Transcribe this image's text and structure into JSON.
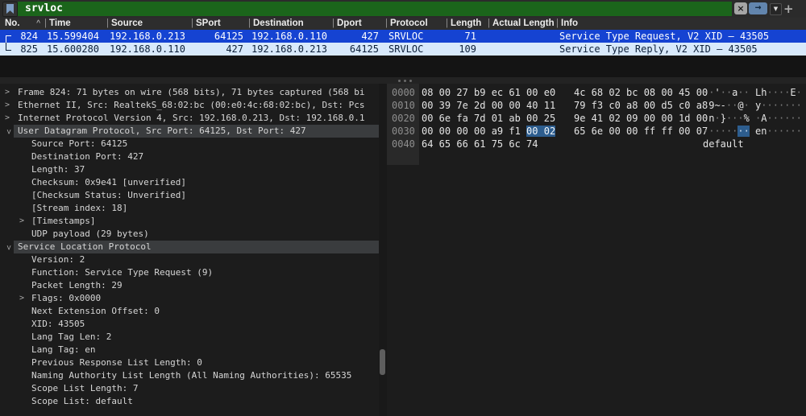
{
  "colors": {
    "filter_green": "#1b651b",
    "selected_row_blue": "#1543d2",
    "related_row_blue": "#d8e9fb",
    "byte_highlight_blue": "#2d5d8e",
    "detail_selected_gray": "#3a3c3e",
    "apply_button_blue": "#6285ad"
  },
  "filter_bar": {
    "query": "srvloc",
    "clear_label": "×",
    "apply_label": "→",
    "dropdown_label": "▼",
    "add_label": "+"
  },
  "packet_list": {
    "columns": [
      {
        "key": "no",
        "label": "No.",
        "sort": "^"
      },
      {
        "key": "time",
        "label": "Time"
      },
      {
        "key": "source",
        "label": "Source"
      },
      {
        "key": "sport",
        "label": "SPort"
      },
      {
        "key": "destination",
        "label": "Destination"
      },
      {
        "key": "dport",
        "label": "Dport"
      },
      {
        "key": "protocol",
        "label": "Protocol"
      },
      {
        "key": "length",
        "label": "Length"
      },
      {
        "key": "actual_length",
        "label": "Actual Length"
      },
      {
        "key": "info",
        "label": "Info"
      }
    ],
    "rows": [
      {
        "no": "824",
        "time": "15.599404",
        "source": "192.168.0.213",
        "sport": "64125",
        "destination": "192.168.0.110",
        "dport": "427",
        "protocol": "SRVLOC",
        "length": "71",
        "actual_length": "",
        "info": "Service Type Request, V2 XID – 43505",
        "selected": true,
        "bracket": "start"
      },
      {
        "no": "825",
        "time": "15.600280",
        "source": "192.168.0.110",
        "sport": "427",
        "destination": "192.168.0.213",
        "dport": "64125",
        "protocol": "SRVLOC",
        "length": "109",
        "actual_length": "",
        "info": "Service Type Reply, V2 XID – 43505",
        "selected": false,
        "bracket": "end"
      }
    ]
  },
  "packet_details": {
    "rows": [
      {
        "depth": 0,
        "chev": "collapsed",
        "text": "Frame 824: 71 bytes on wire (568 bits), 71 bytes captured (568 bi"
      },
      {
        "depth": 0,
        "chev": "collapsed",
        "text": "Ethernet II, Src: RealtekS_68:02:bc (00:e0:4c:68:02:bc), Dst: Pcs"
      },
      {
        "depth": 0,
        "chev": "collapsed",
        "text": "Internet Protocol Version 4, Src: 192.168.0.213, Dst: 192.168.0.1"
      },
      {
        "depth": 0,
        "chev": "expanded",
        "selected": true,
        "text": "User Datagram Protocol, Src Port: 64125, Dst Port: 427"
      },
      {
        "depth": 1,
        "text": "Source Port: 64125"
      },
      {
        "depth": 1,
        "text": "Destination Port: 427"
      },
      {
        "depth": 1,
        "text": "Length: 37"
      },
      {
        "depth": 1,
        "text": "Checksum: 0x9e41 [unverified]"
      },
      {
        "depth": 1,
        "text": "[Checksum Status: Unverified]"
      },
      {
        "depth": 1,
        "text": "[Stream index: 18]"
      },
      {
        "depth": 1,
        "chev": "collapsed",
        "text": "[Timestamps]"
      },
      {
        "depth": 1,
        "text": "UDP payload (29 bytes)"
      },
      {
        "depth": 0,
        "chev": "expanded",
        "selected": true,
        "text": "Service Location Protocol"
      },
      {
        "depth": 1,
        "text": "Version: 2"
      },
      {
        "depth": 1,
        "text": "Function: Service Type Request (9)"
      },
      {
        "depth": 1,
        "text": "Packet Length: 29"
      },
      {
        "depth": 1,
        "chev": "collapsed",
        "text": "Flags: 0x0000"
      },
      {
        "depth": 1,
        "text": "Next Extension Offset: 0"
      },
      {
        "depth": 1,
        "text": "XID: 43505"
      },
      {
        "depth": 1,
        "text": "Lang Tag Len: 2"
      },
      {
        "depth": 1,
        "text": "Lang Tag: en"
      },
      {
        "depth": 1,
        "text": "Previous Response List Length: 0"
      },
      {
        "depth": 1,
        "text": "Naming Authority List Length (All Naming Authorities): 65535"
      },
      {
        "depth": 1,
        "text": "Scope List Length: 7"
      },
      {
        "depth": 1,
        "text": "Scope List: default"
      }
    ]
  },
  "packet_bytes": {
    "rows": [
      {
        "offset": "0000",
        "g1": [
          "08",
          "00",
          "27",
          "b9",
          "ec",
          "61",
          "00",
          "e0"
        ],
        "g2": [
          "4c",
          "68",
          "02",
          "bc",
          "08",
          "00",
          "45",
          "00"
        ],
        "a1": "··'··a··",
        "a2": "Lh····E·"
      },
      {
        "offset": "0010",
        "g1": [
          "00",
          "39",
          "7e",
          "2d",
          "00",
          "00",
          "40",
          "11"
        ],
        "g2": [
          "79",
          "f3",
          "c0",
          "a8",
          "00",
          "d5",
          "c0",
          "a8"
        ],
        "a1": "·9~-··@·",
        "a2": "y·······"
      },
      {
        "offset": "0020",
        "g1": [
          "00",
          "6e",
          "fa",
          "7d",
          "01",
          "ab",
          "00",
          "25"
        ],
        "g2": [
          "9e",
          "41",
          "02",
          "09",
          "00",
          "00",
          "1d",
          "00"
        ],
        "a1": "·n·}···%",
        "a2": "·A······"
      },
      {
        "offset": "0030",
        "g1": [
          "00",
          "00",
          "00",
          "00",
          "a9",
          "f1",
          "00",
          "02"
        ],
        "g2": [
          "65",
          "6e",
          "00",
          "00",
          "ff",
          "ff",
          "00",
          "07"
        ],
        "a1": "········",
        "a2": "en······",
        "hl_g1": [
          6,
          7
        ],
        "hl_a1": [
          6,
          7
        ]
      },
      {
        "offset": "0040",
        "g1": [
          "64",
          "65",
          "66",
          "61",
          "75",
          "6c",
          "74"
        ],
        "g2": [],
        "a1": "default",
        "a2": ""
      }
    ]
  }
}
